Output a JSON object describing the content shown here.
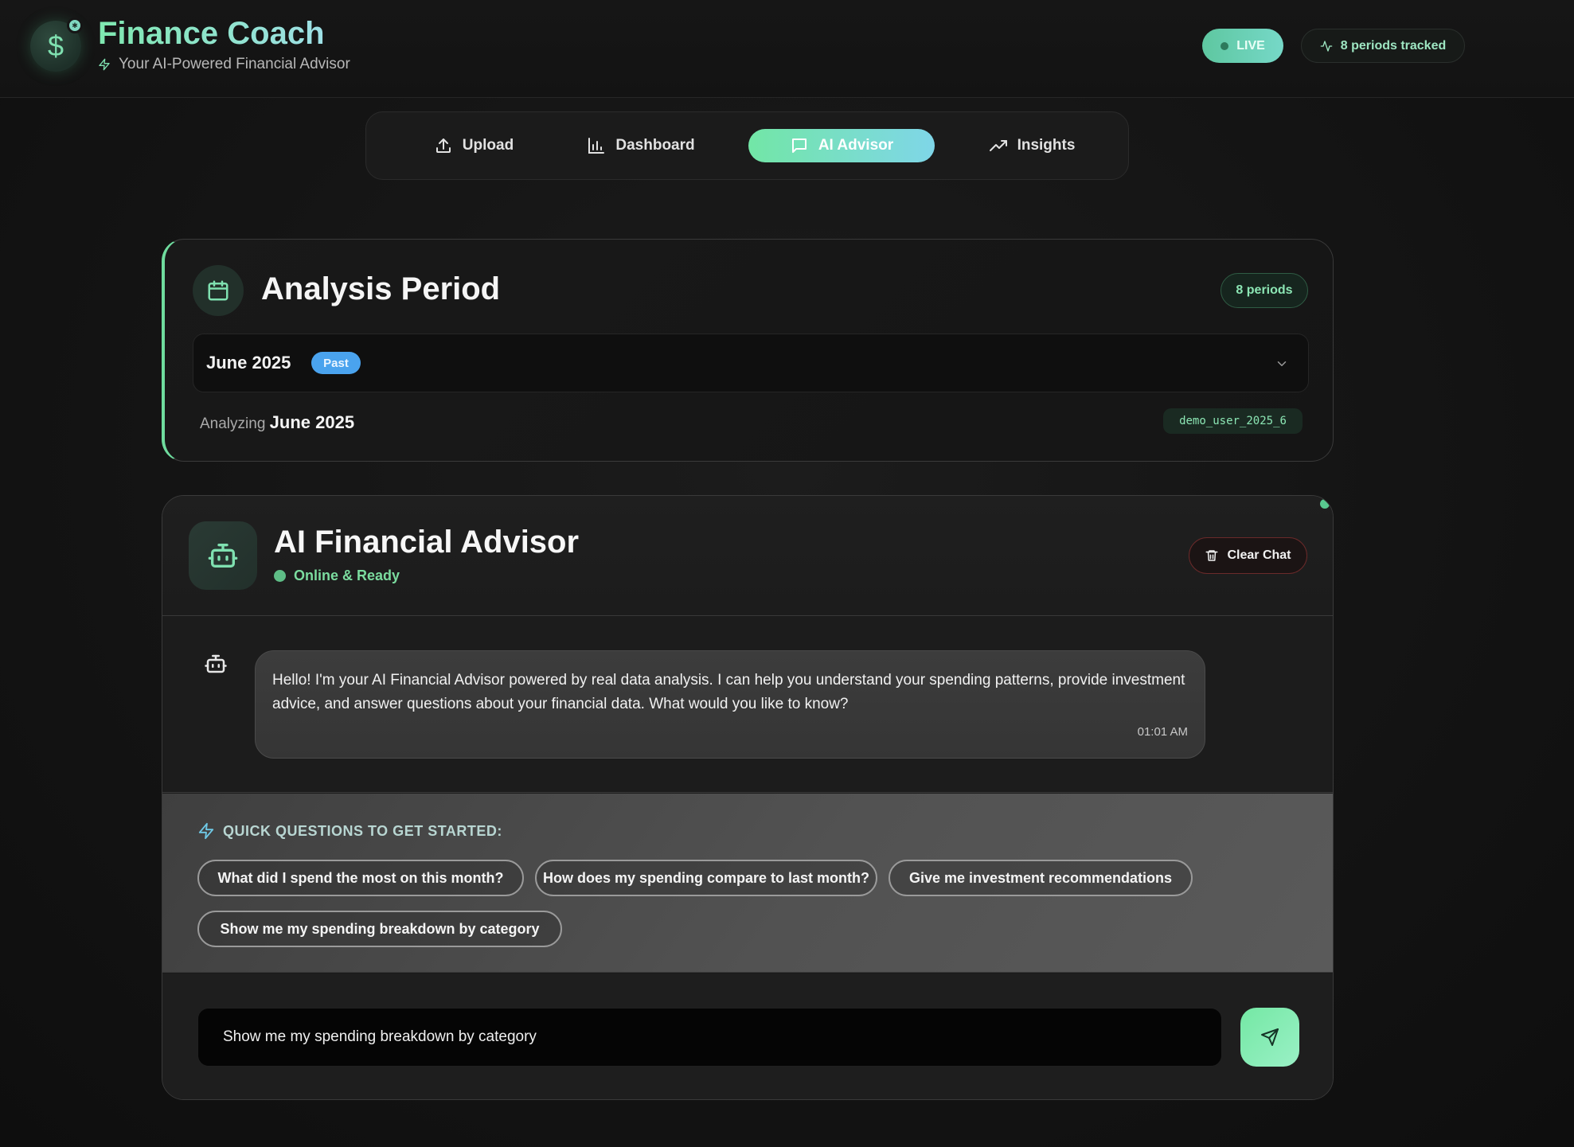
{
  "header": {
    "title": "Finance Coach",
    "subtitle": "Your AI-Powered Financial Advisor",
    "logo_icon": "dollar-icon",
    "live_label": "LIVE",
    "periods_tracked": "8 periods tracked"
  },
  "tabs": [
    {
      "label": "Upload",
      "icon": "upload-icon",
      "active": false
    },
    {
      "label": "Dashboard",
      "icon": "bar-chart-icon",
      "active": false
    },
    {
      "label": "AI Advisor",
      "icon": "chat-bubble-icon",
      "active": true
    },
    {
      "label": "Insights",
      "icon": "trending-up-icon",
      "active": false
    }
  ],
  "analysis_period": {
    "title": "Analysis Period",
    "periods_badge": "8 periods",
    "selected_period": "June 2025",
    "selected_badge": "Past",
    "analyzing_prefix": "Analyzing",
    "analyzing_value": "June 2025",
    "user_id": "demo_user_2025_6"
  },
  "advisor": {
    "title": "AI Financial Advisor",
    "status": "Online & Ready",
    "clear_label": "Clear Chat",
    "messages": [
      {
        "sender": "bot",
        "text": "Hello! I'm your AI Financial Advisor powered by real data analysis. I can help you understand your spending patterns, provide investment advice, and answer questions about your financial data. What would you like to know?",
        "time": "01:01 AM"
      }
    ],
    "quick_title": "QUICK QUESTIONS TO GET STARTED:",
    "quick_questions": [
      "What did I spend the most on this month?",
      "How does my spending compare to last month?",
      "Give me investment recommendations",
      "Show me my spending breakdown by category"
    ],
    "input_value": "Show me my spending breakdown by category"
  },
  "colors": {
    "accent_green": "#72e6a6",
    "accent_cyan": "#7fd6e8",
    "past_badge": "#4aa3ee",
    "clear_border": "#6a2a2a"
  }
}
